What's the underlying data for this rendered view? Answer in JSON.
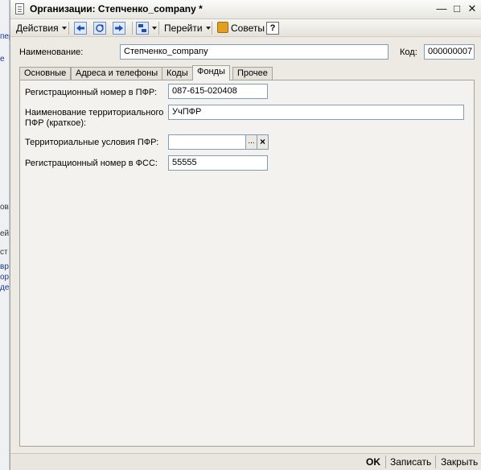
{
  "window": {
    "title": "Организации: Степченко_company *"
  },
  "titlebar_buttons": {
    "minimize": "—",
    "maximize": "□",
    "close": "✕"
  },
  "toolbar": {
    "actions_label": "Действия",
    "goto_label": "Перейти",
    "tips_label": "Советы",
    "help_label": "?"
  },
  "header": {
    "name_label": "Наименование:",
    "name_value": "Степченко_company",
    "code_label": "Код:",
    "code_value": "000000007"
  },
  "tabs": [
    {
      "label": "Основные"
    },
    {
      "label": "Адреса и телефоны"
    },
    {
      "label": "Коды"
    },
    {
      "label": "Фонды",
      "active": true
    },
    {
      "label": "Прочее"
    }
  ],
  "funds": {
    "pfr_reg_label": "Регистрационный номер в ПФР:",
    "pfr_reg_value": "087-615-020408",
    "territorial_name_label_1": "Наименование территориального",
    "territorial_name_label_2": "ПФР (краткое):",
    "territorial_name_value": "УчПФР",
    "territorial_conditions_label": "Территориальные условия ПФР:",
    "territorial_conditions_value": "",
    "select_button": "...",
    "clear_button": "×",
    "fss_reg_label": "Регистрационный номер в ФСС:",
    "fss_reg_value": "55555"
  },
  "footer": {
    "ok_label": "OK",
    "save_label": "Записать",
    "close_label": "Закрыть"
  },
  "background_fragments": [
    "пер",
    "е",
    "ов",
    "ей",
    "ст",
    "вр",
    "ор",
    "де"
  ]
}
